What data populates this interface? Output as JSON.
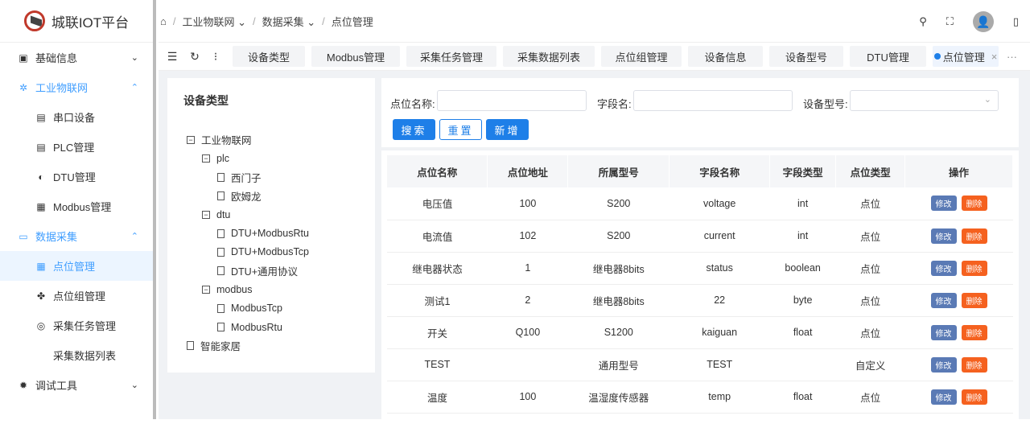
{
  "app": {
    "title": "城联IOT平台"
  },
  "sidebar": {
    "items": [
      {
        "label": "基础信息",
        "icon": "settings-icon"
      },
      {
        "label": "工业物联网",
        "icon": "iot-icon"
      },
      {
        "label": "串口设备",
        "icon": "serial-icon"
      },
      {
        "label": "PLC管理",
        "icon": "plc-icon"
      },
      {
        "label": "DTU管理",
        "icon": "dtu-icon"
      },
      {
        "label": "Modbus管理",
        "icon": "modbus-icon"
      },
      {
        "label": "数据采集",
        "icon": "collect-icon"
      },
      {
        "label": "点位管理",
        "icon": "point-icon"
      },
      {
        "label": "点位组管理",
        "icon": "group-icon"
      },
      {
        "label": "采集任务管理",
        "icon": "task-icon"
      },
      {
        "label": "采集数据列表",
        "icon": ""
      },
      {
        "label": "调试工具",
        "icon": "bug-icon"
      }
    ]
  },
  "breadcrumb": [
    "工业物联网",
    "数据采集",
    "点位管理"
  ],
  "tabs": [
    "设备类型",
    "Modbus管理",
    "采集任务管理",
    "采集数据列表",
    "点位组管理",
    "设备信息",
    "设备型号",
    "DTU管理",
    "点位管理"
  ],
  "tree": {
    "title": "设备类型",
    "nodes": [
      "工业物联网",
      "plc",
      "西门子",
      "欧姆龙",
      "dtu",
      "DTU+ModbusRtu",
      "DTU+ModbusTcp",
      "DTU+通用协议",
      "modbus",
      "ModbusTcp",
      "ModbusRtu",
      "智能家居"
    ]
  },
  "search": {
    "point_name_label": "点位名称:",
    "field_name_label": "字段名:",
    "model_label": "设备型号:",
    "search": "搜索",
    "reset": "重置",
    "add": "新增"
  },
  "table": {
    "headers": [
      "点位名称",
      "点位地址",
      "所属型号",
      "字段名称",
      "字段类型",
      "点位类型",
      "操作"
    ],
    "edit": "修改",
    "delete": "删除",
    "rows": [
      [
        "电压值",
        "100",
        "S200",
        "voltage",
        "int",
        "点位"
      ],
      [
        "电流值",
        "102",
        "S200",
        "current",
        "int",
        "点位"
      ],
      [
        "继电器状态",
        "1",
        "继电器8bits",
        "status",
        "boolean",
        "点位"
      ],
      [
        "测试1",
        "2",
        "继电器8bits",
        "22",
        "byte",
        "点位"
      ],
      [
        "开关",
        "Q100",
        "S1200",
        "kaiguan",
        "float",
        "点位"
      ],
      [
        "TEST",
        "",
        "通用型号",
        "TEST",
        "",
        "自定义"
      ],
      [
        "温度",
        "100",
        "温湿度传感器",
        "temp",
        "float",
        "点位"
      ]
    ]
  }
}
